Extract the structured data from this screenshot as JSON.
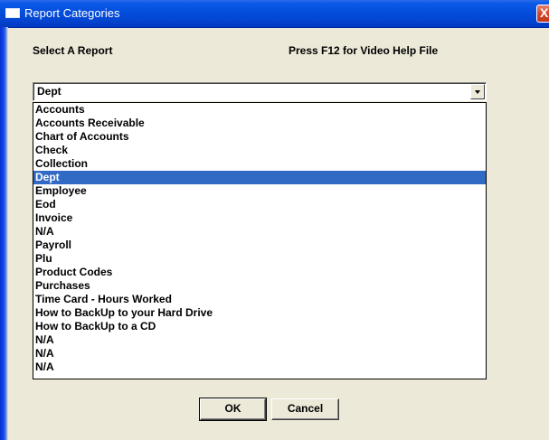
{
  "window": {
    "title": "Report Categories",
    "close_label": "X"
  },
  "labels": {
    "select_report": "Select A Report",
    "help_hint": "Press F12 for Video Help File"
  },
  "combo": {
    "selected_value": "Dept"
  },
  "list": {
    "selected": "Dept",
    "items": [
      "Accounts",
      "Accounts Receivable",
      "Chart of Accounts",
      "Check",
      "Collection",
      "Dept",
      "Employee",
      "Eod",
      "Invoice",
      "N/A",
      "Payroll",
      "Plu",
      "Product Codes",
      "Purchases",
      "Time Card - Hours Worked",
      "How to BackUp to your Hard Drive",
      "How to BackUp to a CD",
      "N/A",
      "N/A",
      "N/A"
    ]
  },
  "buttons": {
    "ok": "OK",
    "cancel": "Cancel"
  },
  "colors": {
    "titlebar": "#0550de",
    "selection": "#316ac5",
    "dialog_bg": "#ece9d8"
  }
}
